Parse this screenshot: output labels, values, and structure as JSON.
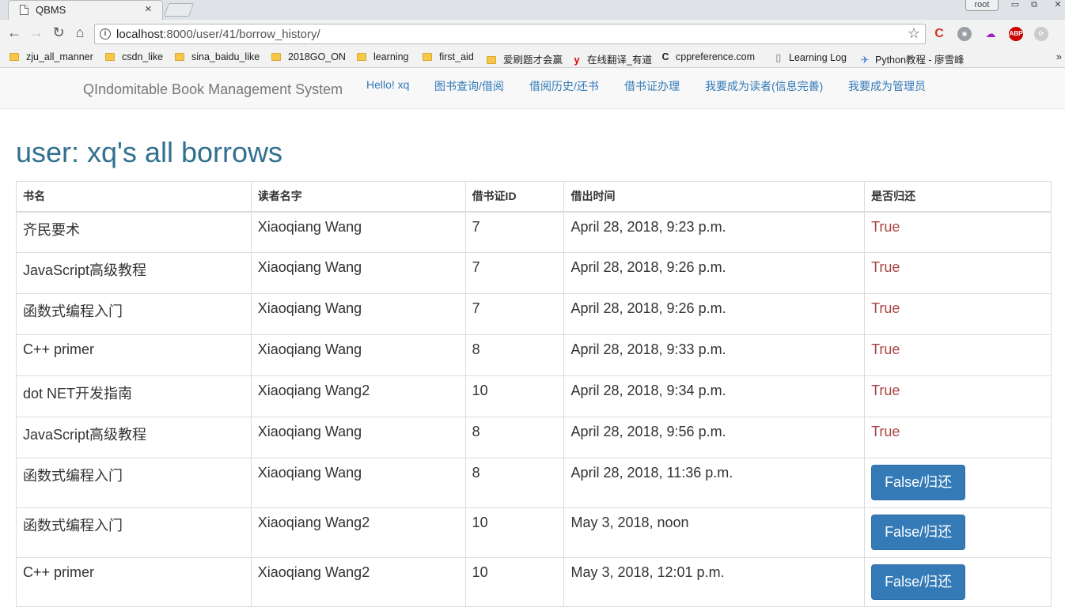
{
  "browser": {
    "tab_title": "QBMS",
    "tab_close": "×",
    "user_badge": "root",
    "url_host": "localhost",
    "url_rest": ":8000/user/41/borrow_history/",
    "bookmarks": [
      {
        "label": "zju_all_manner",
        "icon": "folder-icon"
      },
      {
        "label": "csdn_like",
        "icon": "folder-icon"
      },
      {
        "label": "sina_baidu_like",
        "icon": "folder-icon"
      },
      {
        "label": "2018GO_ON",
        "icon": "folder-icon"
      },
      {
        "label": "learning",
        "icon": "folder-icon"
      },
      {
        "label": "first_aid",
        "icon": "folder-icon"
      },
      {
        "label": "爱刷题才会赢",
        "icon": "folder-icon"
      },
      {
        "label": "在线翻译_有道",
        "icon": "youdao-icon"
      },
      {
        "label": "cppreference.com",
        "icon": "cppreference-icon"
      },
      {
        "label": "Learning Log",
        "icon": "page-icon"
      },
      {
        "label": "Python教程 - 廖雪峰",
        "icon": "python-icon"
      }
    ],
    "overflow": "»"
  },
  "navbar": {
    "brand": "QIndomitable Book Management System",
    "links": [
      "Hello! xq",
      "图书查询/借阅",
      "借阅历史/还书",
      "借书证办理",
      "我要成为读者(信息完善)",
      "我要成为管理员"
    ]
  },
  "page": {
    "title": "user: xq's all borrows"
  },
  "table": {
    "headers": [
      "书名",
      "读者名字",
      "借书证ID",
      "借出时间",
      "是否归还"
    ],
    "rows": [
      {
        "book": "齐民要术",
        "reader": "Xiaoqiang Wang",
        "card_id": "7",
        "time": "April 28, 2018, 9:23 p.m.",
        "returned": "True"
      },
      {
        "book": "JavaScript高级教程",
        "reader": "Xiaoqiang Wang",
        "card_id": "7",
        "time": "April 28, 2018, 9:26 p.m.",
        "returned": "True"
      },
      {
        "book": "函数式编程入门",
        "reader": "Xiaoqiang Wang",
        "card_id": "7",
        "time": "April 28, 2018, 9:26 p.m.",
        "returned": "True"
      },
      {
        "book": "C++ primer",
        "reader": "Xiaoqiang Wang",
        "card_id": "8",
        "time": "April 28, 2018, 9:33 p.m.",
        "returned": "True"
      },
      {
        "book": "dot NET开发指南",
        "reader": "Xiaoqiang Wang2",
        "card_id": "10",
        "time": "April 28, 2018, 9:34 p.m.",
        "returned": "True"
      },
      {
        "book": "JavaScript高级教程",
        "reader": "Xiaoqiang Wang",
        "card_id": "8",
        "time": "April 28, 2018, 9:56 p.m.",
        "returned": "True"
      },
      {
        "book": "函数式编程入门",
        "reader": "Xiaoqiang Wang",
        "card_id": "8",
        "time": "April 28, 2018, 11:36 p.m.",
        "returned": "False/归还"
      },
      {
        "book": "函数式编程入门",
        "reader": "Xiaoqiang Wang2",
        "card_id": "10",
        "time": "May 3, 2018, noon",
        "returned": "False/归还"
      },
      {
        "book": "C++ primer",
        "reader": "Xiaoqiang Wang2",
        "card_id": "10",
        "time": "May 3, 2018, 12:01 p.m.",
        "returned": "False/归还"
      }
    ]
  }
}
